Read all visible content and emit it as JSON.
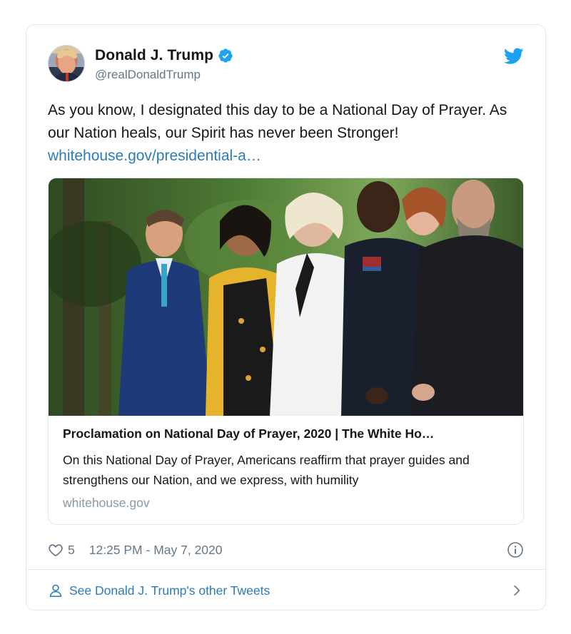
{
  "author": {
    "display_name": "Donald J. Trump",
    "handle": "@realDonaldTrump",
    "verified": true
  },
  "tweet": {
    "text": "As you know, I designated this day to be a National Day of Prayer. As our Nation heals, our Spirit has never been Stronger!",
    "link_text": "whitehouse.gov/presidential-a…"
  },
  "link_card": {
    "title": "Proclamation on National Day of Prayer, 2020 | The White Ho…",
    "description": "On this National Day of Prayer, Americans reaffirm that prayer guides and strengthens our Nation, and we express, with humility",
    "domain": "whitehouse.gov"
  },
  "meta": {
    "like_count": "5",
    "timestamp": "12:25 PM - May 7, 2020"
  },
  "footer": {
    "label": "See Donald J. Trump's other Tweets"
  },
  "colors": {
    "link": "#2b7bb9",
    "twitter_blue": "#1da1f2",
    "muted": "#657786",
    "border": "#e1e8ed"
  },
  "icons": {
    "verified": "verified-badge-icon",
    "brand": "twitter-bird-icon",
    "like": "heart-icon",
    "info": "info-icon",
    "profile": "person-icon",
    "next": "chevron-right-icon"
  }
}
